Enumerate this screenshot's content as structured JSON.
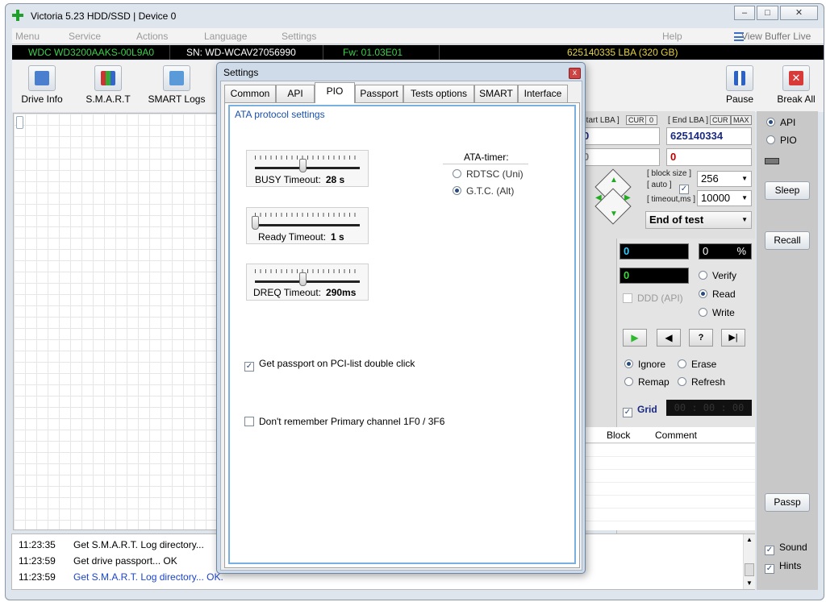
{
  "window": {
    "title": "Victoria 5.23 HDD/SSD | Device 0"
  },
  "menu": {
    "items": [
      "Menu",
      "Service",
      "Actions",
      "Language",
      "Settings",
      "Help"
    ],
    "view_buffer": "View Buffer Live"
  },
  "infobar": {
    "model": "WDC WD3200AAKS-00L9A0",
    "serial": "SN: WD-WCAV27056990",
    "firmware": "Fw: 01.03E01",
    "capacity": "625140335 LBA (320 GB)"
  },
  "toolbar": {
    "drive_info": "Drive Info",
    "smart": "S.M.A.R.T",
    "smart_logs": "SMART Logs",
    "pause": "Pause",
    "break_all": "Break All"
  },
  "right": {
    "api": "API",
    "pio": "PIO",
    "sleep": "Sleep",
    "recall": "Recall",
    "passp": "Passp",
    "sound": "Sound",
    "hints": "Hints"
  },
  "scan": {
    "start_lba_label": "Start LBA ]",
    "cur1": "CUR",
    "zero_btn": "0",
    "end_lba_label": "[ End LBA ]",
    "cur2": "CUR",
    "max_btn": "MAX",
    "start_lba": "0",
    "end_lba": "625140334",
    "start_lba2": "0",
    "end_lba2": "0",
    "block_size_label": "[ block size ]",
    "auto_label": "[ auto ]",
    "timeout_label": "[ timeout,ms ]",
    "block_size": "256",
    "timeout": "10000",
    "end_of_test": "End of test",
    "counter1": "0",
    "percent_val": "0",
    "percent_sign": "%",
    "counter2": "0",
    "verify": "Verify",
    "read": "Read",
    "write": "Write",
    "ddd_api": "DDD (API)",
    "ignore": "Ignore",
    "erase": "Erase",
    "remap": "Remap",
    "refresh": "Refresh",
    "grid": "Grid",
    "timer": "00 : 00 : 00",
    "col_block": "Block",
    "col_comment": "Comment"
  },
  "log": [
    {
      "time": "11:23:35",
      "text": "Get S.M.A.R.T. Log directory...",
      "color": "#000000"
    },
    {
      "time": "11:23:59",
      "text": "Get drive passport... OK",
      "color": "#000000"
    },
    {
      "time": "11:23:59",
      "text": "Get S.M.A.R.T. Log directory... OK.",
      "color": "#1a44c8"
    }
  ],
  "dialog": {
    "title": "Settings",
    "close": "x",
    "tabs": [
      "Common",
      "API",
      "PIO",
      "Passport",
      "Tests options",
      "SMART",
      "Interface"
    ],
    "active_tab": "PIO",
    "section": "ATA protocol settings",
    "sliders": [
      {
        "label": "BUSY Timeout:",
        "value": "28 s",
        "level": 0.45
      },
      {
        "label": "Ready Timeout:",
        "value": "1 s",
        "level": 0.0
      },
      {
        "label": "DREQ Timeout:",
        "value": "290ms",
        "level": 0.45
      }
    ],
    "ata_timer": {
      "title": "ATA-timer:",
      "options": [
        "RDTSC (Uni)",
        "G.T.C.  (Alt)"
      ],
      "selected": 1
    },
    "checkboxes": [
      {
        "label": "Get passport on PCI-list double click",
        "checked": true
      },
      {
        "label": "Don't remember Primary channel 1F0 / 3F6",
        "checked": false
      }
    ]
  },
  "colors": {
    "infobar_green": "#3bd14a",
    "infobar_yellow": "#e6d23a",
    "section_blue": "#1a50a8",
    "play_green": "#2db82d"
  }
}
